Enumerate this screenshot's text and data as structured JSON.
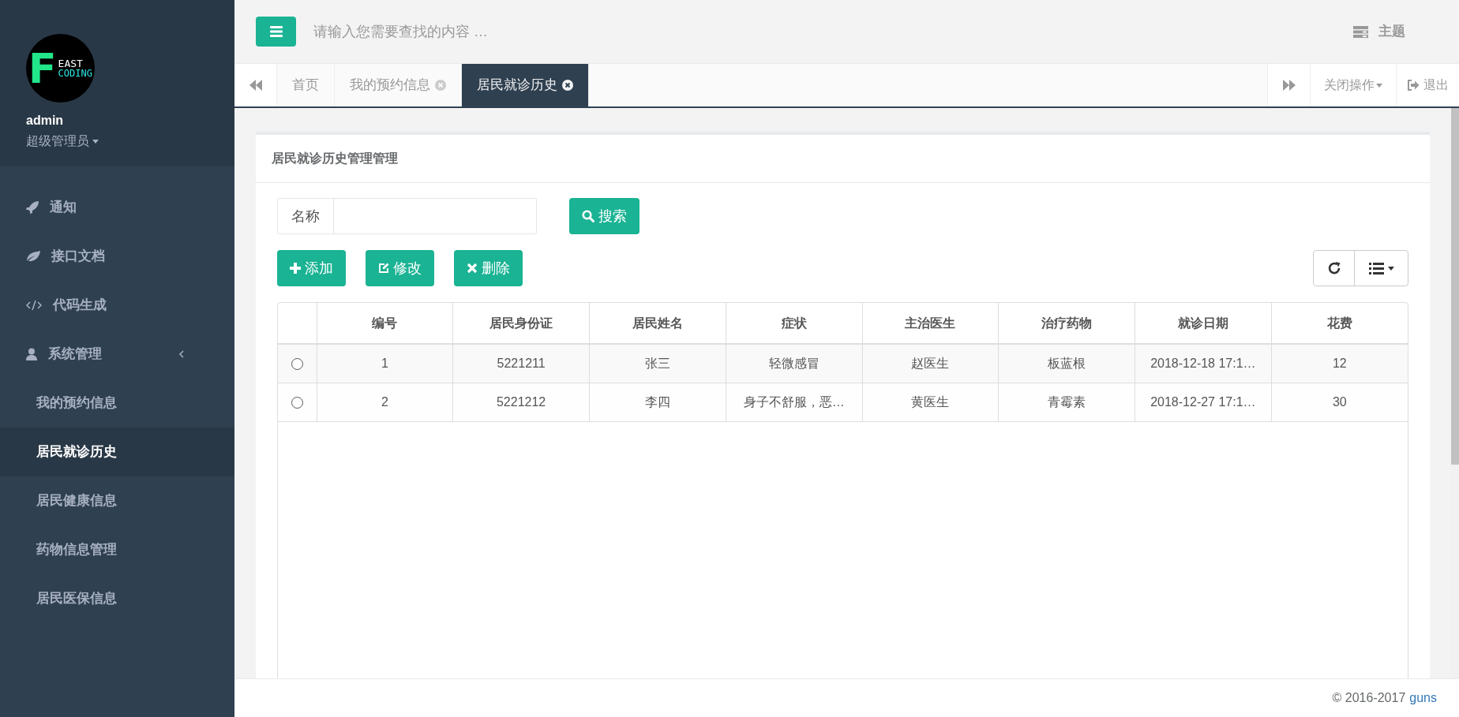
{
  "sidebar": {
    "logo": {
      "letter": "F",
      "line_1": "EAST",
      "line_2": "CODING"
    },
    "user": "admin",
    "role": "超级管理员",
    "items": [
      {
        "kind": "rocket",
        "label": "通知",
        "selected": false
      },
      {
        "kind": "leaf",
        "label": "接口文档",
        "selected": false
      },
      {
        "kind": "code",
        "label": "代码生成",
        "selected": false
      },
      {
        "kind": "user",
        "label": "系统管理",
        "selected": false,
        "expanded": true,
        "children": [
          {
            "label": "我的预约信息",
            "selected": false
          },
          {
            "label": "居民就诊历史",
            "selected": true
          },
          {
            "label": "居民健康信息",
            "selected": false
          },
          {
            "label": "药物信息管理",
            "selected": false
          },
          {
            "label": "居民医保信息",
            "selected": false
          }
        ]
      }
    ]
  },
  "top_bar": {
    "search": {
      "placeholder": "请输入您需要查找的内容 …"
    },
    "theme": "主题"
  },
  "tabs": [
    {
      "label": "首页",
      "selected": false,
      "closable": false
    },
    {
      "label": "我的预约信息",
      "selected": false,
      "closable": true
    },
    {
      "label": "居民就诊历史",
      "selected": true,
      "closable": true
    }
  ],
  "tab_actions": {
    "close_menu": "关闭操作",
    "logout": "退出"
  },
  "panel": {
    "title": "居民就诊历史管理管理",
    "filter": {
      "label": "名称"
    },
    "search_button": "搜索",
    "buttons": [
      {
        "kind": "add",
        "label": "添加"
      },
      {
        "kind": "edit",
        "label": "修改"
      },
      {
        "kind": "delete",
        "label": "删除"
      }
    ]
  },
  "table": {
    "columns": [
      "编号",
      "居民身份证",
      "居民姓名",
      "症状",
      "主治医生",
      "治疗药物",
      "就诊日期",
      "花费"
    ],
    "rows": [
      {
        "selected": false,
        "cells": [
          "1",
          "5221211",
          "张三",
          "轻微感冒",
          "赵医生",
          "板蓝根",
          "2018-12-18 17:1…",
          "12"
        ]
      },
      {
        "selected": false,
        "cells": [
          "2",
          "5221212",
          "李四",
          "身子不舒服，恶…",
          "黄医生",
          "青霉素",
          "2018-12-27 17:1…",
          "30"
        ]
      }
    ]
  },
  "footer": {
    "copyright": "© 2016-2017",
    "link": "guns"
  }
}
